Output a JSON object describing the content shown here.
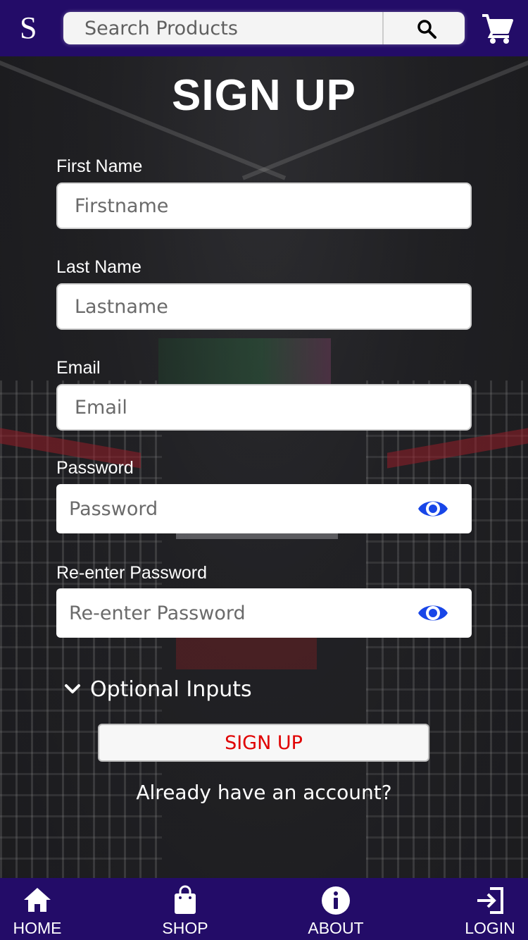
{
  "header": {
    "logo": "S",
    "search_placeholder": "Search Products",
    "search_icon": "search-icon",
    "cart_icon": "cart-icon",
    "background_color": "#230c68"
  },
  "form": {
    "title": "SIGN UP",
    "fields": [
      {
        "label": "First Name",
        "placeholder": "Firstname",
        "value": ""
      },
      {
        "label": "Last Name",
        "placeholder": "Lastname",
        "value": ""
      },
      {
        "label": "Email",
        "placeholder": "Email",
        "value": ""
      },
      {
        "label": "Password",
        "placeholder": "Password",
        "value": "",
        "icon": "eye-icon"
      },
      {
        "label": "Re-enter Password",
        "placeholder": "Re-enter Password",
        "value": "",
        "icon": "eye-icon"
      }
    ],
    "optional_label": "Optional Inputs",
    "optional_icon": "chevron-down-icon",
    "submit_label": "SIGN UP",
    "submit_color": "#e00000",
    "already_account": "Already have an account?",
    "eye_color": "#1846e8"
  },
  "bottom_nav": {
    "items": [
      {
        "label": "HOME",
        "icon": "home-icon"
      },
      {
        "label": "SHOP",
        "icon": "shopping-bag-icon"
      },
      {
        "label": "ABOUT",
        "icon": "info-icon"
      },
      {
        "label": "LOGIN",
        "icon": "login-icon"
      }
    ]
  }
}
